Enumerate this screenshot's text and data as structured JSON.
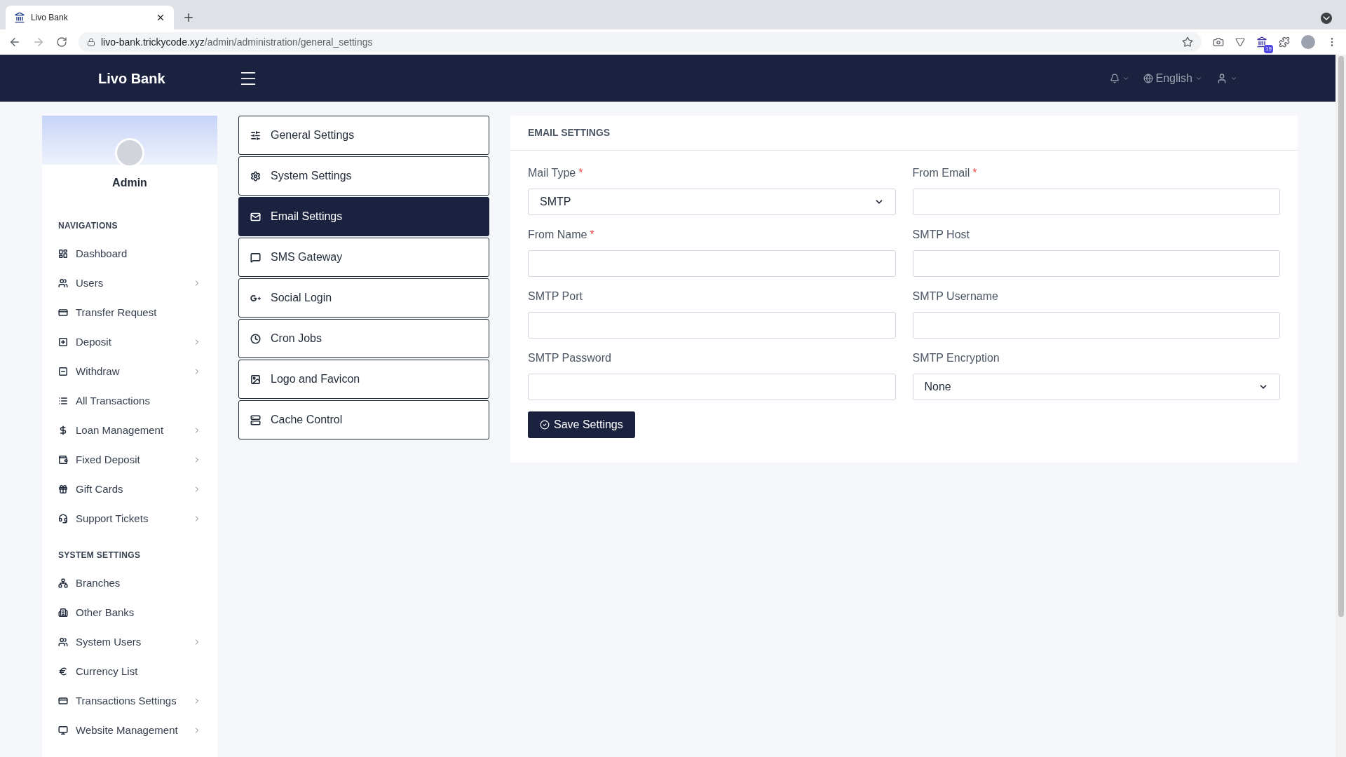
{
  "browser": {
    "tab_title": "Livo Bank",
    "url_host": "livo-bank.trickycode.xyz",
    "url_path": "/admin/administration/general_settings",
    "extension_badge": "19"
  },
  "navbar": {
    "brand": "Livo Bank",
    "language": "English"
  },
  "sidebar": {
    "profile_name": "Admin",
    "sections": [
      {
        "title": "NAVIGATIONS",
        "items": [
          {
            "label": "Dashboard",
            "has_submenu": false
          },
          {
            "label": "Users",
            "has_submenu": true
          },
          {
            "label": "Transfer Request",
            "has_submenu": false
          },
          {
            "label": "Deposit",
            "has_submenu": true
          },
          {
            "label": "Withdraw",
            "has_submenu": true
          },
          {
            "label": "All Transactions",
            "has_submenu": false
          },
          {
            "label": "Loan Management",
            "has_submenu": true
          },
          {
            "label": "Fixed Deposit",
            "has_submenu": true
          },
          {
            "label": "Gift Cards",
            "has_submenu": true
          },
          {
            "label": "Support Tickets",
            "has_submenu": true
          }
        ]
      },
      {
        "title": "SYSTEM SETTINGS",
        "items": [
          {
            "label": "Branches",
            "has_submenu": false
          },
          {
            "label": "Other Banks",
            "has_submenu": false
          },
          {
            "label": "System Users",
            "has_submenu": true
          },
          {
            "label": "Currency List",
            "has_submenu": false
          },
          {
            "label": "Transactions Settings",
            "has_submenu": true
          },
          {
            "label": "Website Management",
            "has_submenu": true
          }
        ]
      }
    ]
  },
  "settings_menu": [
    {
      "label": "General Settings",
      "selected": false
    },
    {
      "label": "System Settings",
      "selected": false
    },
    {
      "label": "Email Settings",
      "selected": true
    },
    {
      "label": "SMS Gateway",
      "selected": false
    },
    {
      "label": "Social Login",
      "selected": false
    },
    {
      "label": "Cron Jobs",
      "selected": false
    },
    {
      "label": "Logo and Favicon",
      "selected": false
    },
    {
      "label": "Cache Control",
      "selected": false
    }
  ],
  "form": {
    "title": "EMAIL SETTINGS",
    "fields": [
      {
        "label": "Mail Type",
        "required_mark": "*",
        "kind": "select",
        "value": "SMTP"
      },
      {
        "label": "From Email",
        "required_mark": "*",
        "kind": "text"
      },
      {
        "label": "From Name",
        "required_mark": "*",
        "kind": "text"
      },
      {
        "label": "SMTP Host",
        "kind": "text"
      },
      {
        "label": "SMTP Port",
        "kind": "text"
      },
      {
        "label": "SMTP Username",
        "kind": "text"
      },
      {
        "label": "SMTP Password",
        "kind": "text"
      },
      {
        "label": "SMTP Encryption",
        "kind": "select",
        "value": "None"
      }
    ],
    "save_button": "Save Settings"
  }
}
